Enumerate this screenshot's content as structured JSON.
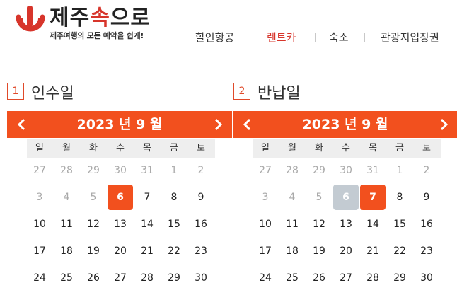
{
  "brand": {
    "name_dark_1": "제주",
    "name_red": "속",
    "name_dark_2": "으로",
    "tagline": "제주여행의 모든 예약을 쉽게!",
    "accent": "#f2501e",
    "logo_red": "#d7352b"
  },
  "nav": {
    "items": [
      {
        "label": "할인항공"
      },
      {
        "label": "렌트카"
      },
      {
        "label": "숙소"
      },
      {
        "label": "관광지입장권"
      }
    ],
    "active_index": 1
  },
  "steps": {
    "pickup": {
      "num": "1",
      "label": "인수일"
    },
    "return": {
      "num": "2",
      "label": "반납일"
    }
  },
  "weekdays": [
    "일",
    "월",
    "화",
    "수",
    "목",
    "금",
    "토"
  ],
  "calendars": [
    {
      "title": "2023 년 9 월",
      "selected": "6",
      "weeks": [
        [
          "27",
          "28",
          "29",
          "30",
          "31",
          "1",
          "2"
        ],
        [
          "3",
          "4",
          "5",
          "6",
          "7",
          "8",
          "9"
        ],
        [
          "10",
          "11",
          "12",
          "13",
          "14",
          "15",
          "16"
        ],
        [
          "17",
          "18",
          "19",
          "20",
          "21",
          "22",
          "23"
        ],
        [
          "24",
          "25",
          "26",
          "27",
          "28",
          "29",
          "30"
        ]
      ]
    },
    {
      "title": "2023 년 9 월",
      "start_marker": "6",
      "selected": "7",
      "weeks": [
        [
          "27",
          "28",
          "29",
          "30",
          "31",
          "1",
          "2"
        ],
        [
          "3",
          "4",
          "5",
          "6",
          "7",
          "8",
          "9"
        ],
        [
          "10",
          "11",
          "12",
          "13",
          "14",
          "15",
          "16"
        ],
        [
          "17",
          "18",
          "19",
          "20",
          "21",
          "22",
          "23"
        ],
        [
          "24",
          "25",
          "26",
          "27",
          "28",
          "29",
          "30"
        ]
      ]
    }
  ]
}
